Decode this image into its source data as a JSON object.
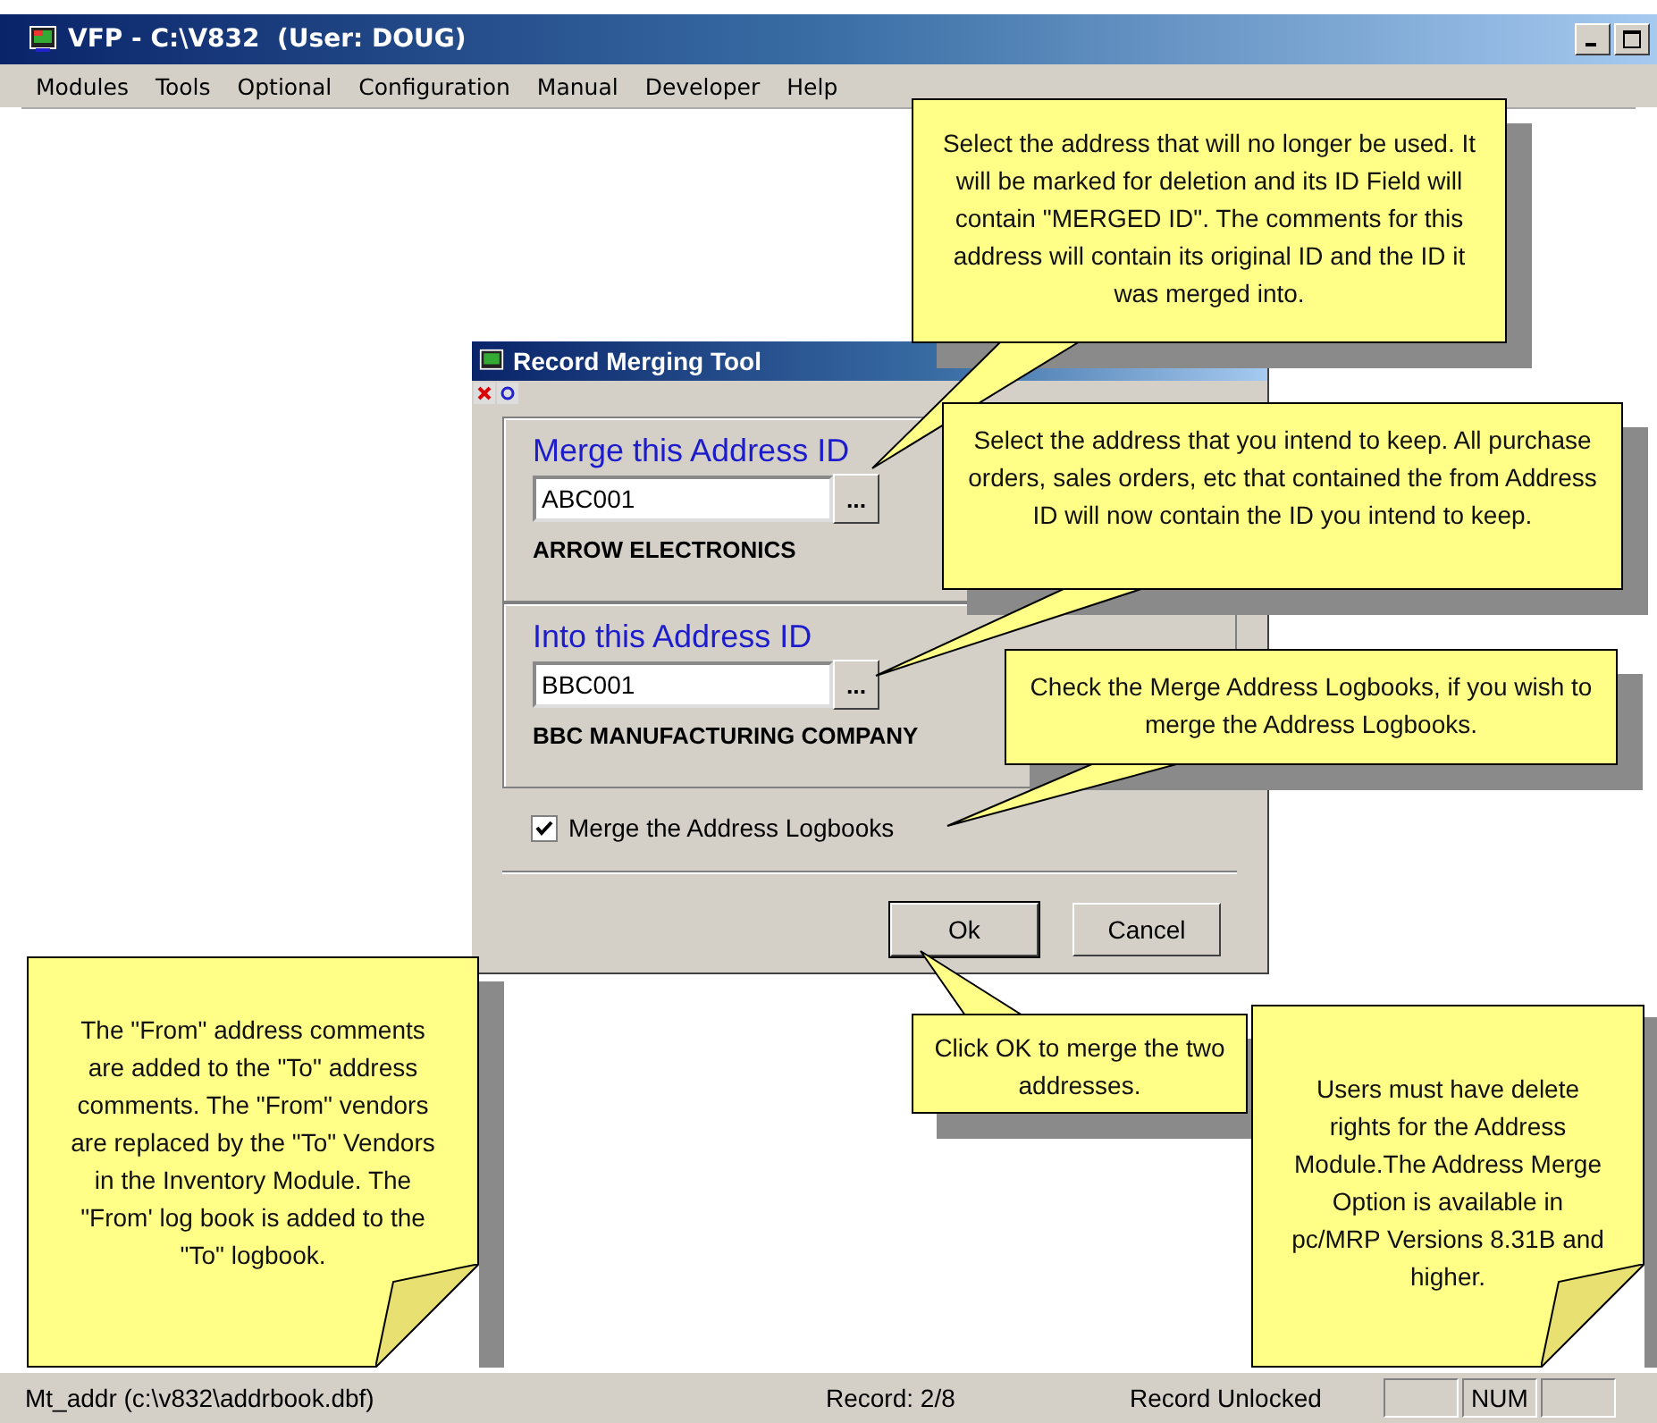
{
  "window": {
    "title": "VFP - C:\\V832  (User: DOUG)"
  },
  "menu": [
    "Modules",
    "Tools",
    "Optional",
    "Configuration",
    "Manual",
    "Developer",
    "Help"
  ],
  "dialog": {
    "title": "Record Merging Tool",
    "groups": [
      {
        "label": "Merge this Address ID",
        "value": "ABC001",
        "browse": "...",
        "name": "ARROW ELECTRONICS"
      },
      {
        "label": "Into this Address ID",
        "value": "BBC001",
        "browse": "...",
        "name": "BBC MANUFACTURING COMPANY"
      }
    ],
    "checkbox": {
      "label": "Merge the Address Logbooks",
      "checked": true
    },
    "buttons": [
      "Ok",
      "Cancel"
    ]
  },
  "callouts": [
    {
      "kind": "balloon",
      "text": "Select the address that will no longer be used. It will be marked for deletion and  its ID Field will contain \"MERGED ID\".  The comments for this address will contain its original ID and the ID it was merged into."
    },
    {
      "kind": "balloon",
      "text": "Select the address that you intend to keep.  All purchase orders, sales orders, etc that contained the from Address ID will now contain the ID you intend to keep."
    },
    {
      "kind": "balloon",
      "text": "Check the Merge Address Logbooks, if you wish to merge the Address Logbooks."
    },
    {
      "kind": "balloon",
      "text": "Click OK to merge the two addresses."
    },
    {
      "kind": "note",
      "text": "The \"From\" address comments are added to the \"To\" address comments.  The \"From\" vendors are replaced by the \"To\" Vendors in the Inventory Module.  The \"From' log book is added to the \"To\" logbook."
    },
    {
      "kind": "note",
      "text": "Users must have delete rights for the Address Module.The Address Merge Option is available in pc/MRP Versions 8.31B and higher."
    }
  ],
  "status_bar": [
    "Mt_addr (c:\\v832\\addrbook.dbf)",
    "Record: 2/8",
    "Record Unlocked",
    "NUM"
  ]
}
